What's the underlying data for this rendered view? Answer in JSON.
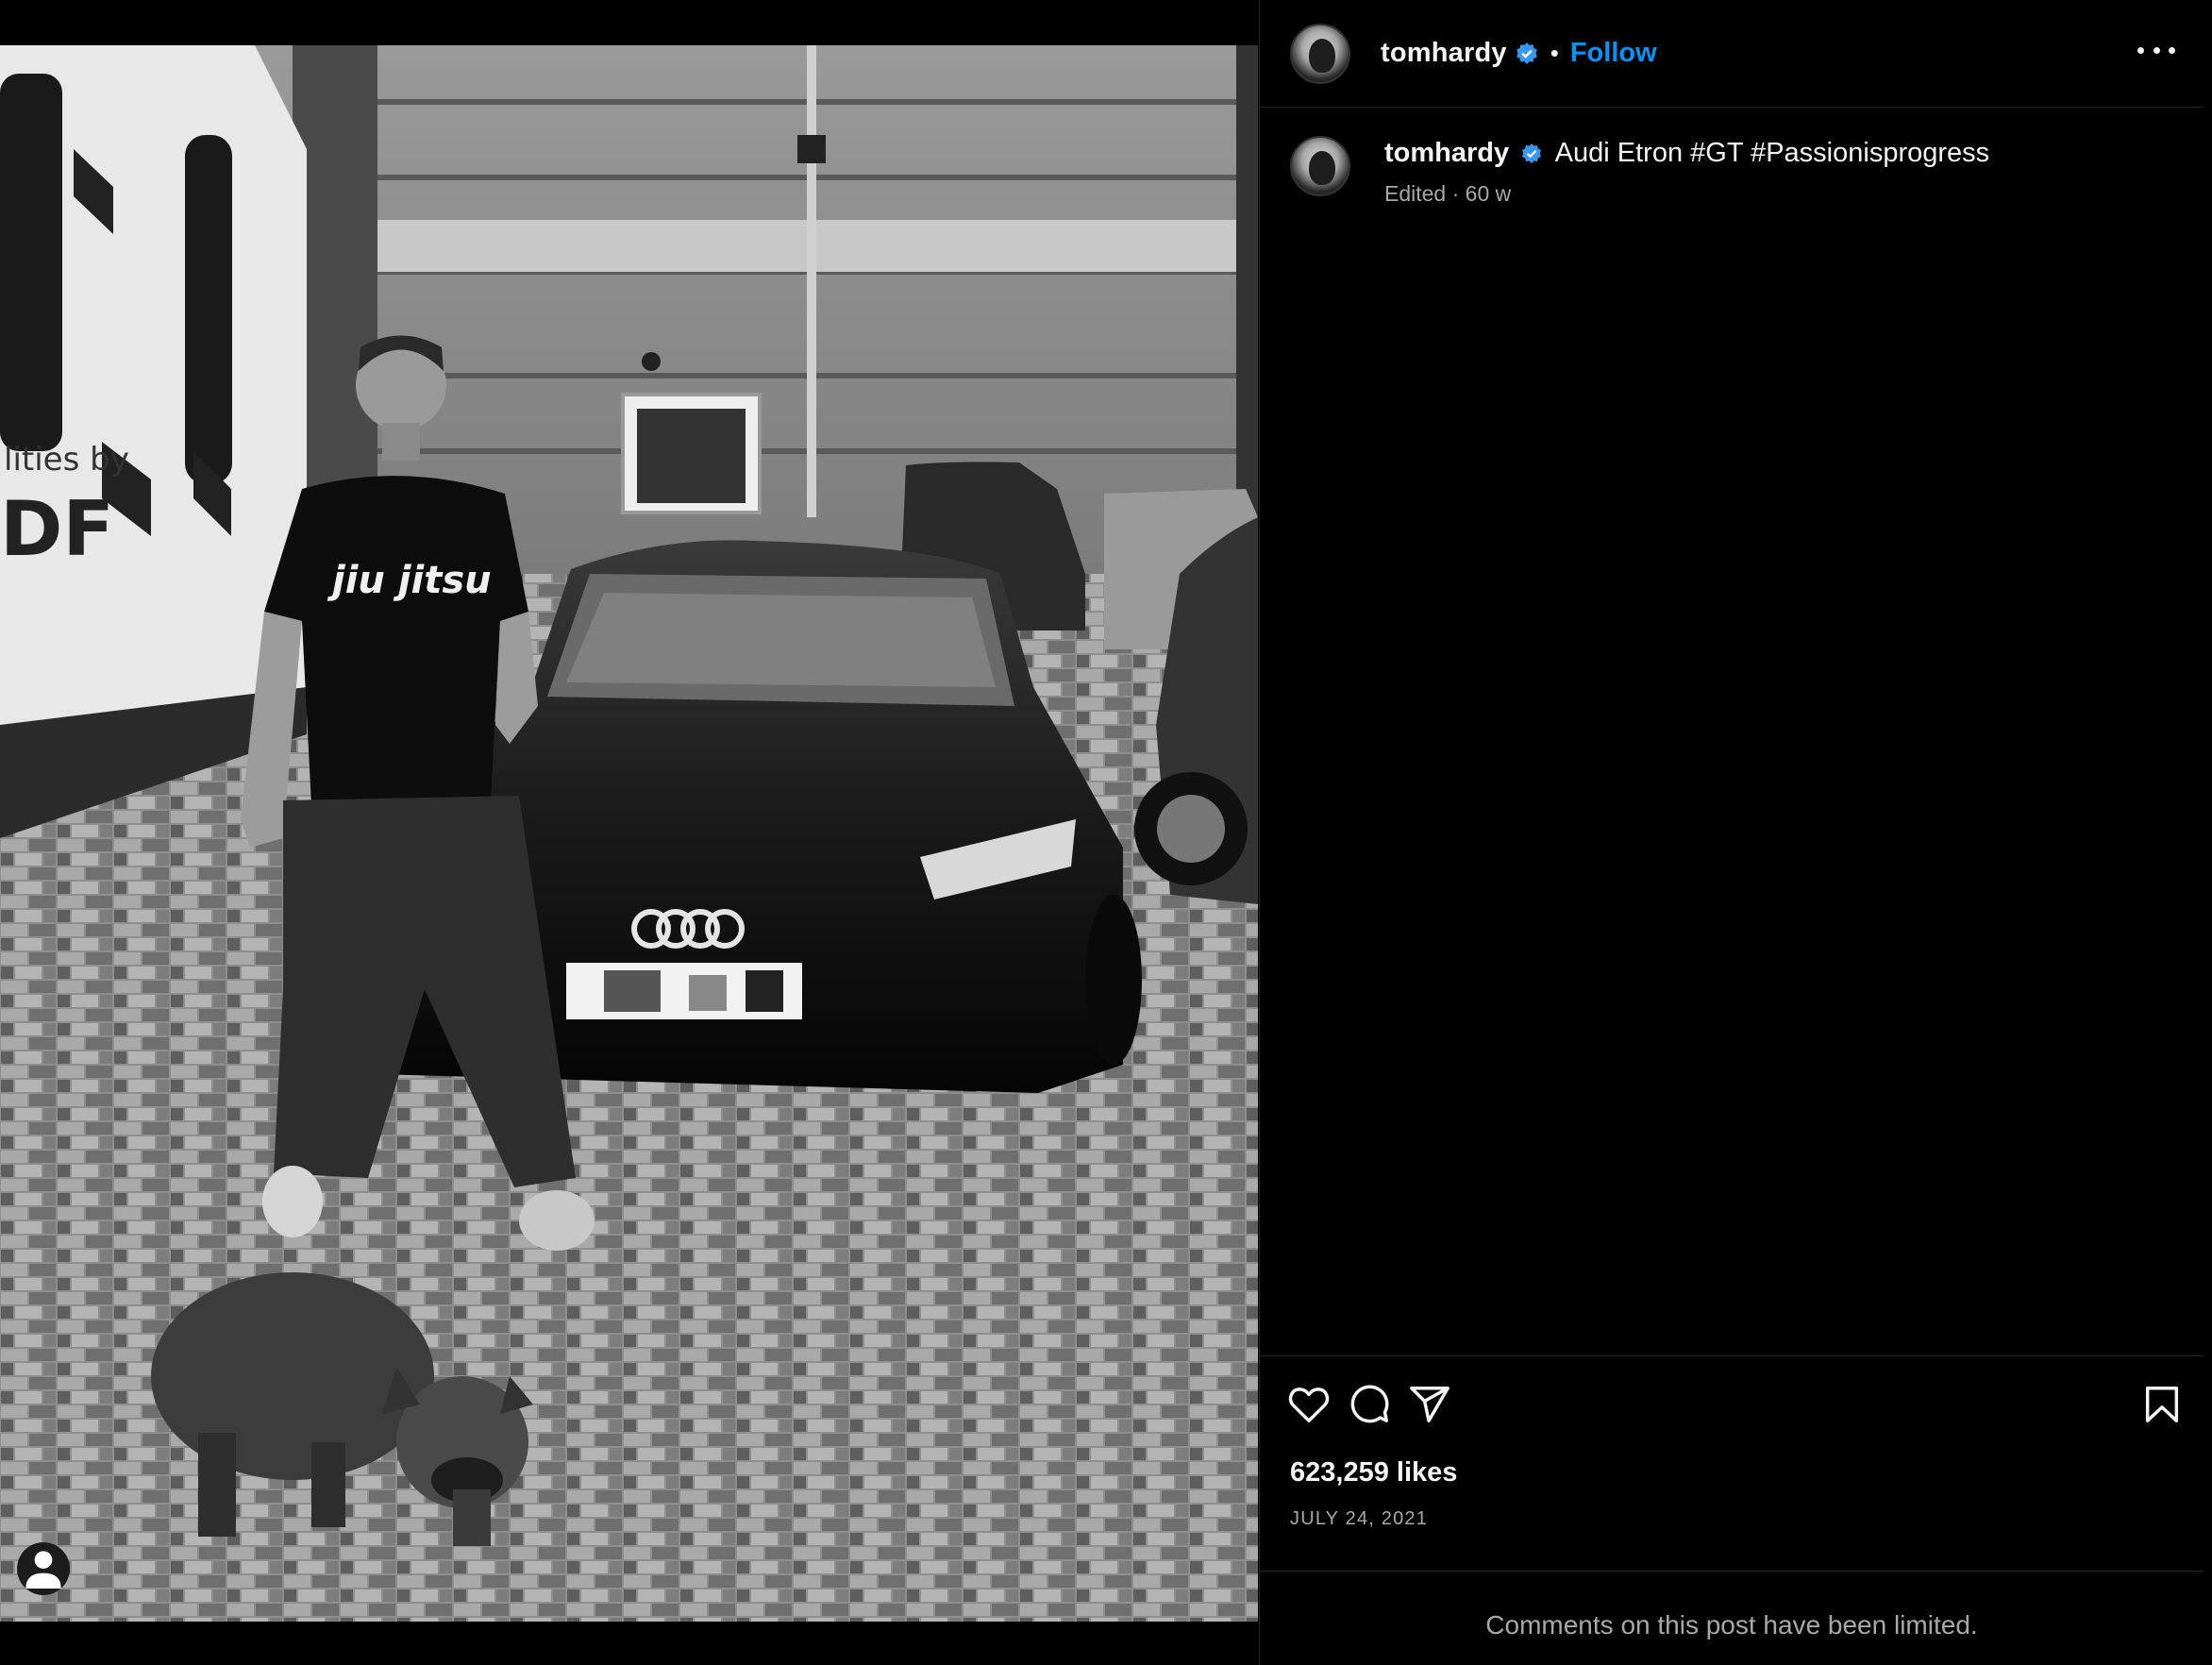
{
  "post": {
    "username": "tomhardy",
    "follow_label": "Follow",
    "separator": "•",
    "caption_username": "tomhardy",
    "caption": "Audi Etron #GT #Passionisprogress",
    "caption_meta": "Edited · 60 w",
    "likes": "623,259 likes",
    "date": "JULY 24, 2021",
    "comments_notice": "Comments on this post have been limited."
  },
  "photo": {
    "shirt_text": "jiu jitsu",
    "trailer_text_1": "lities by",
    "trailer_text_2": "DF"
  },
  "icons": {
    "like": "heart-icon",
    "comment": "comment-icon",
    "share": "send-icon",
    "save": "bookmark-icon",
    "more": "more-icon",
    "tag": "user-tag-icon",
    "verified": "verified-badge-icon"
  },
  "colors": {
    "accent": "#0095f6",
    "verified": "#3897f0",
    "background": "#000000",
    "muted_text": "#a8a8a8"
  }
}
